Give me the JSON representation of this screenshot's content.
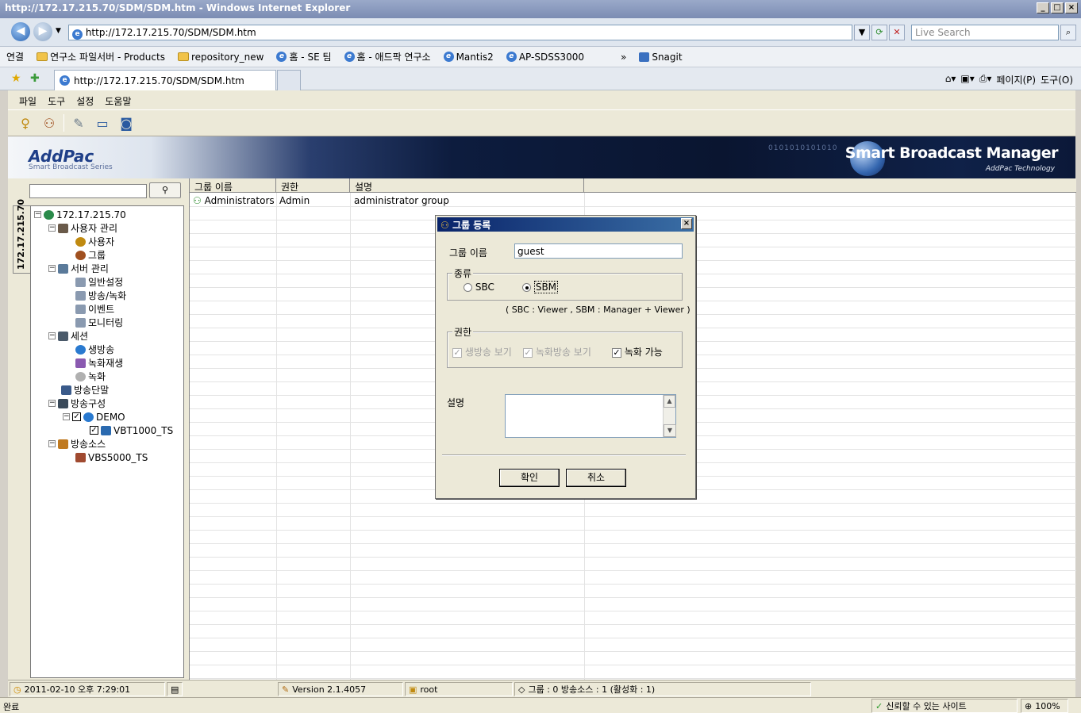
{
  "browser": {
    "title": "http://172.17.215.70/SDM/SDM.htm - Windows Internet Explorer",
    "address": "http://172.17.215.70/SDM/SDM.htm",
    "search_placeholder": "Live Search",
    "favorites": {
      "label": "연결",
      "items": [
        "연구소 파일서버 - Products",
        "repository_new",
        "홈 - SE 팀",
        "홈 - 애드팍 연구소",
        "Mantis2",
        "AP-SDSS3000"
      ],
      "more": "»",
      "snagit": "Snagit"
    },
    "tab_title": "http://172.17.215.70/SDM/SDM.htm",
    "commands": {
      "page": "페이지(P)",
      "tools": "도구(O)"
    },
    "status_done": "완료",
    "status_zone": "신뢰할 수 있는 사이트",
    "zoom": "100%"
  },
  "app": {
    "menu": [
      "파일",
      "도구",
      "설정",
      "도움말"
    ],
    "banner": {
      "logo": "AddPac",
      "logo_sub": "Smart Broadcast Series",
      "product": "Smart Broadcast Manager",
      "tech": "AddPac Technology",
      "binary": "0101010101010"
    },
    "search_button": "Q",
    "vertical_tab": "172.17.215.70",
    "tree": {
      "root": "172.17.215.70",
      "user_mgmt": "사용자 관리",
      "users": "사용자",
      "groups": "그룹",
      "server_mgmt": "서버 관리",
      "general": "일반설정",
      "broadcast_record": "방송/녹화",
      "events": "이벤트",
      "monitoring": "모니터링",
      "session": "세션",
      "live": "생방송",
      "playback": "녹화재생",
      "recording": "녹화",
      "terminals": "방송단말",
      "config": "방송구성",
      "demo": "DEMO",
      "vbt": "VBT1000_TS",
      "sources": "방송소스",
      "vbs": "VBS5000_TS"
    },
    "grid": {
      "columns": [
        "그룹 이름",
        "권한",
        "설명"
      ],
      "rows": [
        {
          "name": "Administrators",
          "role": "Admin",
          "desc": "administrator group"
        }
      ]
    },
    "status": {
      "datetime": "2011-02-10 오후 7:29:01",
      "version": "Version 2.1.4057",
      "user": "root",
      "summary": "그룹 : 0  방송소스 : 1 (활성화 : 1)"
    }
  },
  "dialog": {
    "title": "그룹 등록",
    "name_label": "그룹 이름",
    "name_value": "guest",
    "type_legend": "종류",
    "type_options": [
      "SBC",
      "SBM"
    ],
    "type_selected": "SBM",
    "type_note": "( SBC : Viewer ,  SBM : Manager + Viewer )",
    "perm_legend": "권한",
    "perms": [
      {
        "label": "생방송 보기",
        "checked": true,
        "disabled": true
      },
      {
        "label": "녹화방송 보기",
        "checked": true,
        "disabled": true
      },
      {
        "label": "녹화 가능",
        "checked": true,
        "disabled": false
      }
    ],
    "desc_label": "설명",
    "desc_value": "",
    "ok": "확인",
    "cancel": "취소"
  },
  "colors": {
    "titlebar": "#0a246a",
    "banner_dark": "#0d1c3e",
    "window_bg": "#ece9d8"
  }
}
